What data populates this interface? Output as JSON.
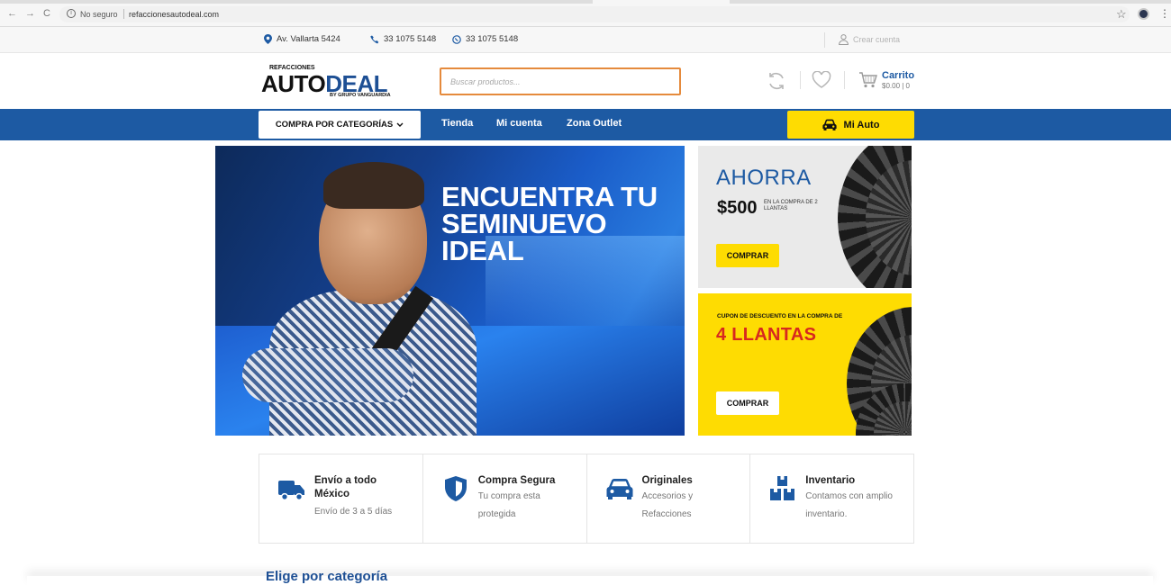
{
  "browser": {
    "security_label": "No seguro",
    "url": "refaccionesautodeal.com",
    "back_icon": "←",
    "forward_icon": "→",
    "reload_icon": "C",
    "star_icon": "☆",
    "menu_icon": "⋮"
  },
  "topbar": {
    "address": "Av. Vallarta 5424",
    "phone": "33 1075 5148",
    "whatsapp": "33 1075 5148",
    "create_account": "Crear cuenta"
  },
  "header": {
    "logo_top": "REFACCIONES",
    "logo_auto": "AUTO",
    "logo_deal": "DEAL",
    "logo_sub": "BY GRUPO VANGUARDIA",
    "search_placeholder": "Buscar productos...",
    "cart_label": "Carrito",
    "cart_total": "$0.00 | 0"
  },
  "nav": {
    "categories_label": "COMPRA POR CATEGORÍAS",
    "links": [
      "Tienda",
      "Mi cuenta",
      "Zona Outlet"
    ],
    "mi_auto_label": "Mi Auto"
  },
  "hero": {
    "headline": "ENCUENTRA TU SEMINUEVO IDEAL"
  },
  "promo1": {
    "title": "AHORRA",
    "price": "$500",
    "note": "EN LA COMPRA DE 2 LLANTAS",
    "button": "COMPRAR"
  },
  "promo2": {
    "kicker": "CUPON DE DESCUENTO EN LA COMPRA DE",
    "title": "4 LLANTAS",
    "button": "COMPRAR"
  },
  "features": [
    {
      "title": "Envío a todo México",
      "desc": "Envío de 3 a 5 días"
    },
    {
      "title": "Compra Segura",
      "desc": "Tu compra esta protegida"
    },
    {
      "title": "Originales",
      "desc": "Accesorios y Refacciones"
    },
    {
      "title": "Inventario",
      "desc": "Contamos con amplio inventario."
    }
  ],
  "section_title": "Elige por categoría",
  "colors": {
    "brand_blue": "#1d5aa3",
    "accent_yellow": "#fedc02",
    "search_border": "#e58a3c",
    "promo_red": "#d7281f"
  }
}
